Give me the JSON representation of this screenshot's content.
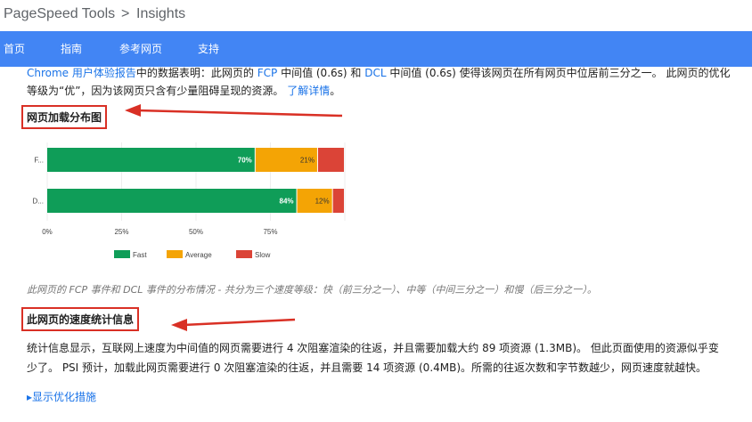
{
  "breadcrumb": {
    "app": "PageSpeed Tools",
    "separator": ">",
    "page": "Insights"
  },
  "nav": {
    "items": [
      "首页",
      "指南",
      "参考网页",
      "支持"
    ]
  },
  "intro": {
    "line1_a": "Chrome 用户体验报告",
    "line1_b": "中的数据表明：此网页的 ",
    "fcp": "FCP",
    "line1_c": " 中间值 (0.6s) 和 ",
    "dcl": "DCL",
    "line1_d": " 中间值 (0.6s) 使得该网页在所有网页中位居前三分之一。 此网页的优化",
    "line2": "等级为“优”，因为该网页只含有少量阻碍呈现的资源。 ",
    "learn_more": "了解详情",
    "line2_end": "。"
  },
  "section1": {
    "title": "网页加载分布图"
  },
  "section2": {
    "title": "此网页的速度统计信息"
  },
  "chart_data": {
    "type": "bar",
    "orientation": "horizontal",
    "stacked": true,
    "categories": [
      "F...",
      "D..."
    ],
    "series": [
      {
        "name": "Fast",
        "values": [
          70,
          84
        ],
        "color": "#0f9d58",
        "labels": [
          "70%",
          "84%"
        ]
      },
      {
        "name": "Average",
        "values": [
          21,
          12
        ],
        "color": "#f4a405",
        "labels": [
          "21%",
          "12%"
        ]
      },
      {
        "name": "Slow",
        "values": [
          9,
          4
        ],
        "color": "#db4437",
        "labels": [
          "",
          ""
        ]
      }
    ],
    "xticks": [
      "0%",
      "25%",
      "50%",
      "75%"
    ],
    "xlim": [
      0,
      100
    ],
    "legend": "bottom"
  },
  "caption": "此网页的 FCP 事件和 DCL 事件的分布情况 - 共分为三个速度等级：快（前三分之一）、中等（中间三分之一）和慢（后三分之一）。",
  "stats": {
    "line1": "统计信息显示，互联网上速度为中间值的网页需要进行 4 次阻塞渲染的往返，并且需要加载大约 89 项资源 (1.3MB)。 但此页面使用的资源似乎变",
    "line2": "少了。 PSI 预计，加载此网页需要进行 0 次阻塞渲染的往返，并且需要 14 项资源 (0.4MB)。所需的往返次数和字节数越少，网页速度就越快。"
  },
  "show_more": "▸显示优化措施",
  "colors": {
    "nav_bg": "#4285f4",
    "link": "#1a73e8",
    "annotation": "#d93025"
  }
}
